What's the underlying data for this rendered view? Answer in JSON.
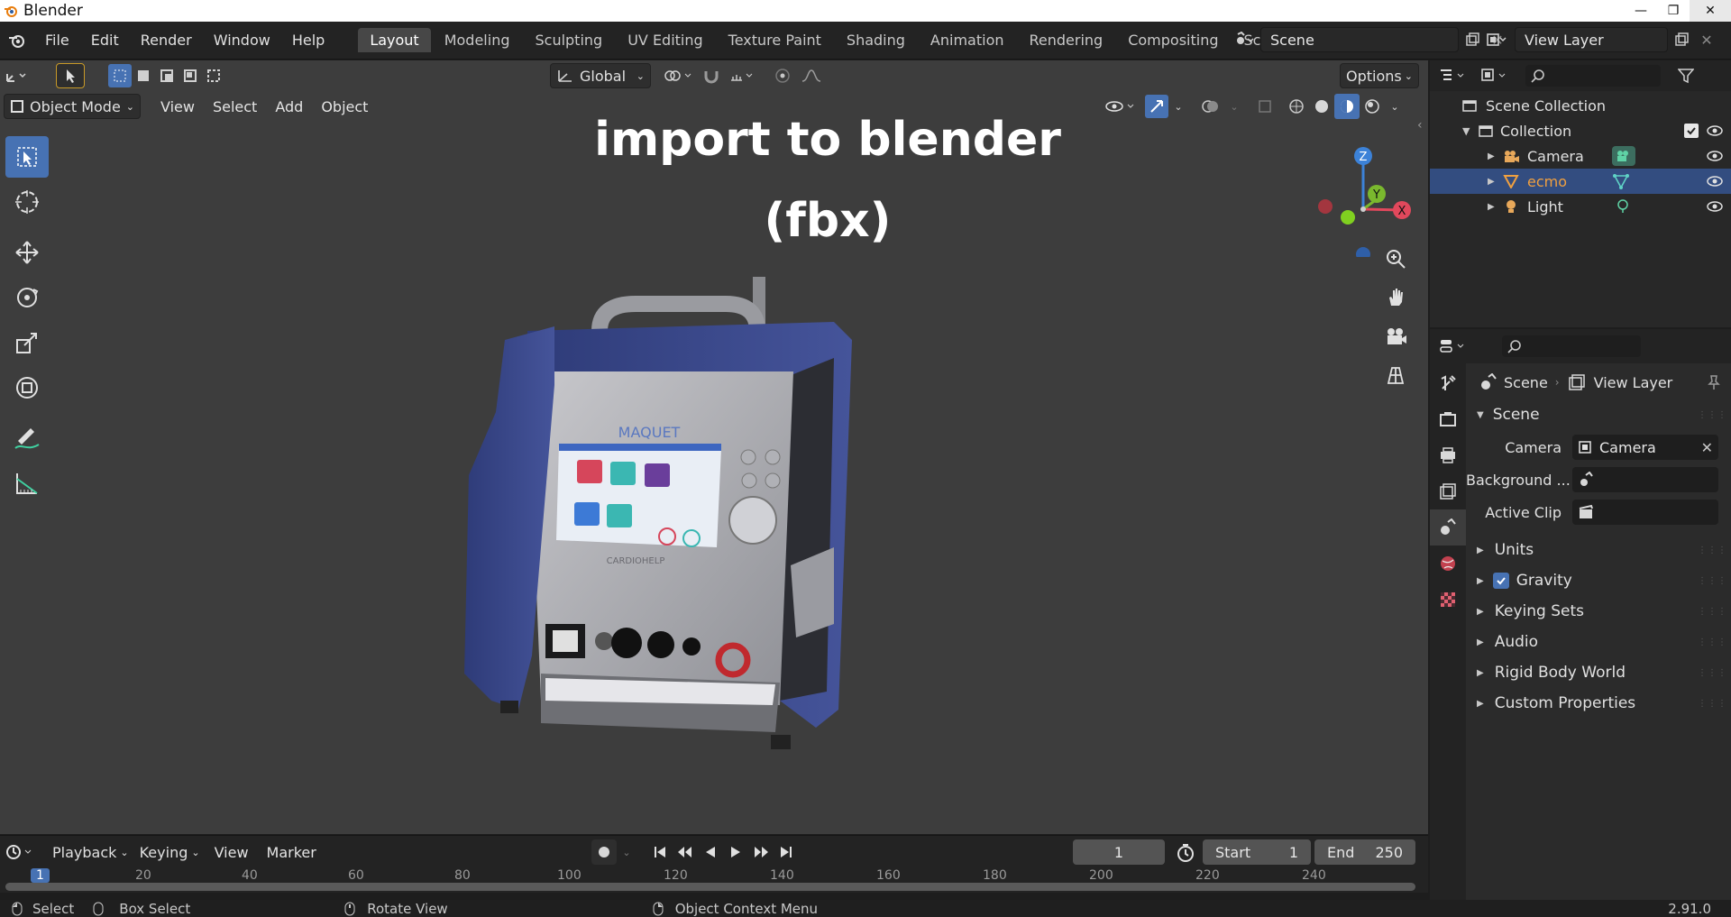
{
  "window": {
    "title": "Blender"
  },
  "menu": {
    "items": [
      "File",
      "Edit",
      "Render",
      "Window",
      "Help"
    ]
  },
  "workspaces": [
    "Layout",
    "Modeling",
    "Sculpting",
    "UV Editing",
    "Texture Paint",
    "Shading",
    "Animation",
    "Rendering",
    "Compositing",
    "Scripting"
  ],
  "active_workspace": "Layout",
  "scene_selector": "Scene",
  "view_layer_selector": "View Layer",
  "viewport": {
    "transform_orientation": "Global",
    "options_label": "Options",
    "mode": "Object Mode",
    "menus": [
      "View",
      "Select",
      "Add",
      "Object"
    ],
    "overlay_title": "import to blender",
    "overlay_subtitle": "(fbx)",
    "model": {
      "brand": "MAQUET",
      "product": "CARDIOHELP"
    }
  },
  "gizmo": {
    "x": "X",
    "y": "Y",
    "z": "Z"
  },
  "outliner": {
    "root": "Scene Collection",
    "collection": "Collection",
    "items": [
      {
        "name": "Camera",
        "selected": false
      },
      {
        "name": "ecmo",
        "selected": true
      },
      {
        "name": "Light",
        "selected": false
      }
    ]
  },
  "properties": {
    "breadcrumb_scene": "Scene",
    "breadcrumb_view_layer": "View Layer",
    "section_scene": "Scene",
    "camera_label": "Camera",
    "camera_value": "Camera",
    "background_label": "Background ...",
    "active_clip_label": "Active Clip",
    "collapsed_sections": [
      "Units",
      "Gravity",
      "Keying Sets",
      "Audio",
      "Rigid Body World",
      "Custom Properties"
    ],
    "gravity_checked": true
  },
  "timeline": {
    "menus": [
      "Playback",
      "Keying",
      "View",
      "Marker"
    ],
    "current_frame": "1",
    "start_label": "Start",
    "start_value": "1",
    "end_label": "End",
    "end_value": "250",
    "ruler": [
      "1",
      "20",
      "40",
      "60",
      "80",
      "100",
      "120",
      "140",
      "160",
      "180",
      "200",
      "220",
      "240"
    ]
  },
  "statusbar": {
    "select": "Select",
    "box_select": "Box Select",
    "rotate_view": "Rotate View",
    "context_menu": "Object Context Menu",
    "version": "2.91.0"
  },
  "colors": {
    "accent": "#4772b3",
    "selected_row": "#334d80",
    "ecmo_text": "#f0a040",
    "viewport_bg": "#3d3d3d"
  }
}
